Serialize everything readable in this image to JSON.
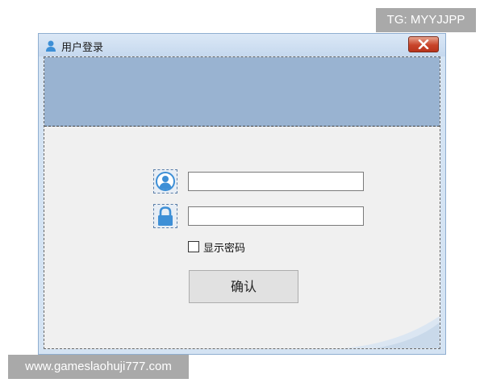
{
  "window": {
    "title": "用户登录",
    "icons": {
      "app": "app-icon",
      "close": "close-icon"
    }
  },
  "form": {
    "username": {
      "value": "",
      "placeholder": "",
      "icon": "user-icon"
    },
    "password": {
      "value": "",
      "placeholder": "",
      "icon": "lock-icon"
    },
    "show_password_label": "显示密码",
    "show_password_checked": false,
    "confirm_label": "确认"
  },
  "watermarks": {
    "top": "TG: MYYJJPP",
    "bottom": "www.gameslaohuji777.com"
  },
  "colors": {
    "banner": "#99b3d1",
    "window_frame": "#d4e3f3",
    "client_bg": "#f0f0f0",
    "close_button": "#c8442a",
    "icon_blue": "#3d8fd6"
  }
}
